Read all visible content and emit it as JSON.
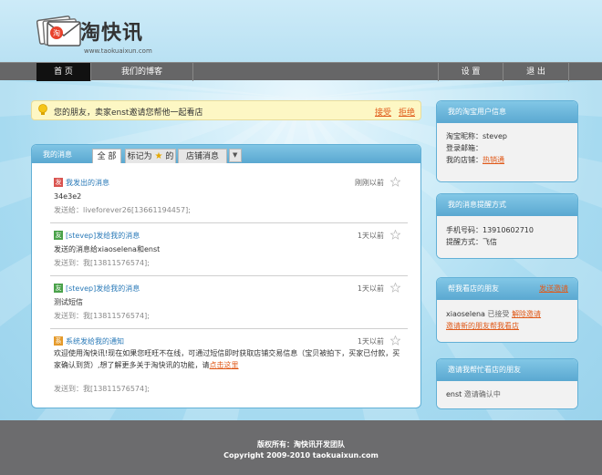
{
  "logo": {
    "name": "淘快讯",
    "url": "www.taokuaixun.com",
    "icon": "envelope-logo-icon"
  },
  "nav": {
    "items": [
      {
        "label": "首 页",
        "active": true
      },
      {
        "label": "我们的博客",
        "active": false
      },
      {
        "label": "设 置",
        "active": false
      },
      {
        "label": "退 出",
        "active": false
      }
    ]
  },
  "notice": {
    "text": "您的朋友，卖家enst邀请您帮他一起看店",
    "accept": "接受",
    "reject": "拒绝",
    "icon": "lightbulb-icon"
  },
  "messages_panel": {
    "title": "我的消息",
    "tabs": [
      "全 部",
      "标记为",
      "的",
      "店铺消息"
    ],
    "items": [
      {
        "icon": "sent-icon",
        "icon_char": "发",
        "icon_color": "#d9534f",
        "title": "我发出的消息",
        "time": "刚刚以前",
        "body": "34e3e2",
        "meta": "发送给：liveforever26[13661194457];"
      },
      {
        "icon": "friend-icon",
        "icon_char": "友",
        "icon_color": "#4aa24a",
        "title": "[stevep]发给我的消息",
        "time": "1天以前",
        "body": "发送的消息给xiaoselena和enst",
        "meta": "发送到：我[13811576574];"
      },
      {
        "icon": "friend-icon",
        "icon_char": "友",
        "icon_color": "#4aa24a",
        "title": "[stevep]发给我的消息",
        "time": "1天以前",
        "body": "测试短信",
        "meta": "发送到：我[13811576574];"
      },
      {
        "icon": "system-icon",
        "icon_char": "系",
        "icon_color": "#e59a2a",
        "title": "系统发给我的通知",
        "time": "1天以前",
        "body": "欢迎使用淘快讯!现在如果您旺旺不在线，可通过短信即时获取店铺交易信息（宝贝被拍下，买家已付款，买家确认到货）,想了解更多关于淘快讯的功能，请",
        "body_link": "点击这里",
        "meta": "发送到：我[13811576574];"
      }
    ]
  },
  "sidebar": {
    "user_info": {
      "title": "我的淘宝用户信息",
      "nickname_label": "淘宝昵称：",
      "nickname": "stevep",
      "email_label": "登录邮箱：",
      "email": "",
      "shop_label": "我的店铺：",
      "shop": "热销通"
    },
    "reminder": {
      "title": "我的消息提醒方式",
      "phone_label": "手机号码：",
      "phone": "13910602710",
      "method_label": "提醒方式：",
      "method": "飞信"
    },
    "helpers": {
      "title": "帮我看店的朋友",
      "invite_link": "发送邀请",
      "friend": "xiaoselena",
      "status": "已接受",
      "remove": "解除邀请",
      "invite_new": "邀请新的朋友帮我看店"
    },
    "invited_by": {
      "title": "邀请我帮忙看店的朋友",
      "friend": "enst",
      "status": "邀请确认中"
    }
  },
  "footer": {
    "line1": "版权所有：淘快讯开发团队",
    "line2": "Copyright 2009-2010 taokuaixun.com"
  }
}
